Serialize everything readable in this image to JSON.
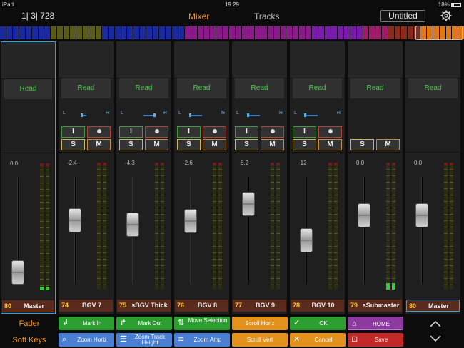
{
  "status": {
    "device": "iPad",
    "time": "19:29",
    "battery": "18%"
  },
  "header": {
    "position": "1| 3| 728",
    "tabs": [
      {
        "label": "Mixer",
        "active": true
      },
      {
        "label": "Tracks",
        "active": false
      }
    ],
    "title": "Untitled",
    "settings_icon": "gear-icon"
  },
  "overview_colors": [
    "#1a2a9e",
    "#1a2a9e",
    "#1a2a9e",
    "#1a2a9e",
    "#1a2a9e",
    "#1a2a9e",
    "#1a2a9e",
    "#1a2a9e",
    "#5a5a1a",
    "#5a5a1a",
    "#5a5a1a",
    "#5a5a1a",
    "#5a5a1a",
    "#5a5a1a",
    "#5a5a1a",
    "#5a5a1a",
    "#1a2a9e",
    "#1a2a9e",
    "#1a2a9e",
    "#1a2a9e",
    "#1a2a9e",
    "#1a2a9e",
    "#1a2a9e",
    "#1a2a9e",
    "#1a2a9e",
    "#1a2a9e",
    "#1a2a9e",
    "#1a2a9e",
    "#1a2a9e",
    "#8a1a8a",
    "#8a1a8a",
    "#8a1a8a",
    "#8a1a8a",
    "#8a1a8a",
    "#8a1a8a",
    "#8a1a8a",
    "#8a1a8a",
    "#8a1a8a",
    "#8a1a8a",
    "#8a1a8a",
    "#8a1a8a",
    "#8a1a8a",
    "#8a1a8a",
    "#8a1a8a",
    "#8a1a8a",
    "#8a1a8a",
    "#8a1a8a",
    "#8a1a8a",
    "#8a1a8a",
    "#7a1aaa",
    "#7a1aaa",
    "#7a1aaa",
    "#7a1aaa",
    "#7a1aaa",
    "#7a1aaa",
    "#7a1aaa",
    "#7a1aaa",
    "#a01a6a",
    "#a01a6a",
    "#a01a6a",
    "#a01a6a",
    "#8a2a1a",
    "#8a2a1a",
    "#8a2a1a",
    "#8a2a1a",
    "#8a2a1a",
    "#e0781a",
    "#e0781a",
    "#e0781a",
    "#e0781a",
    "#e0781a",
    "#e0781a",
    "#e0781a"
  ],
  "mixer": {
    "read_label": "Read",
    "input_label": "I",
    "solo_label": "S",
    "mute_label": "M",
    "pan_left": "L",
    "pan_right": "R",
    "strips": [
      {
        "num": "80",
        "name": "Master",
        "db": "0.0",
        "fader": 0.0,
        "pan": null,
        "buttons": false,
        "selected": true,
        "level": 0.03
      },
      {
        "num": "74",
        "name": "BGV 7",
        "db": "-2.4",
        "fader": 0.62,
        "pan": 0.33,
        "buttons": true,
        "rec_armed": true,
        "selected": false,
        "level": 0
      },
      {
        "num": "75",
        "name": "sBGV Thick",
        "db": "-4.3",
        "fader": 0.57,
        "pan": 0.8,
        "buttons": true,
        "rec_armed": true,
        "selected": false,
        "level": 0
      },
      {
        "num": "76",
        "name": "BGV 8",
        "db": "-2.6",
        "fader": 0.61,
        "pan": 0.1,
        "buttons": true,
        "rec_armed": true,
        "selected": false,
        "level": 0
      },
      {
        "num": "77",
        "name": "BGV 9",
        "db": "6.2",
        "fader": 0.82,
        "pan": 0.12,
        "buttons": true,
        "rec_armed": true,
        "selected": false,
        "level": 0
      },
      {
        "num": "78",
        "name": "BGV 10",
        "db": "-12",
        "fader": 0.38,
        "pan": 0.08,
        "buttons": true,
        "rec_armed": true,
        "selected": false,
        "level": 0
      },
      {
        "num": "79",
        "name": "sSubmaster",
        "db": "0.0",
        "fader": 0.68,
        "pan": null,
        "buttons": "sm",
        "selected": false,
        "level": 0.05
      },
      {
        "num": "80",
        "name": "Master",
        "db": "0.0",
        "fader": 0.68,
        "pan": null,
        "buttons": false,
        "selected": false,
        "master_highlight": true,
        "level": 0
      }
    ]
  },
  "side": {
    "fader_label": "Fader",
    "softkeys_label": "Soft Keys"
  },
  "softkeys": [
    {
      "label": "Mark In",
      "color": "green",
      "icon": "mark-in-icon",
      "glyph": "↲"
    },
    {
      "label": "Mark Out",
      "color": "green",
      "icon": "mark-out-icon",
      "glyph": "↱"
    },
    {
      "label": "Move Selection",
      "color": "green",
      "icon": "move-selection-icon",
      "glyph": "⇅"
    },
    {
      "label": "Scroll Horiz",
      "color": "orange",
      "icon": "",
      "glyph": ""
    },
    {
      "label": "OK",
      "color": "green",
      "icon": "checkmark-icon",
      "glyph": "✓"
    },
    {
      "label": "HOME",
      "color": "purple",
      "icon": "home-icon",
      "glyph": "⌂"
    },
    {
      "label": "Zoom Horiz",
      "color": "blue",
      "icon": "zoom-icon",
      "glyph": "⌕"
    },
    {
      "label": "Zoom Track Height",
      "color": "blue",
      "icon": "track-height-icon",
      "glyph": "☰"
    },
    {
      "label": "Zoom Amp",
      "color": "blue",
      "icon": "waveform-icon",
      "glyph": "≋"
    },
    {
      "label": "Scroll Vert",
      "color": "orange",
      "icon": "",
      "glyph": ""
    },
    {
      "label": "Cancel",
      "color": "orange",
      "icon": "close-icon",
      "glyph": "✕"
    },
    {
      "label": "Save",
      "color": "red",
      "icon": "save-icon",
      "glyph": "⊡"
    }
  ],
  "nav": {
    "up_icon": "chevron-up-icon",
    "down_icon": "chevron-down-icon"
  }
}
